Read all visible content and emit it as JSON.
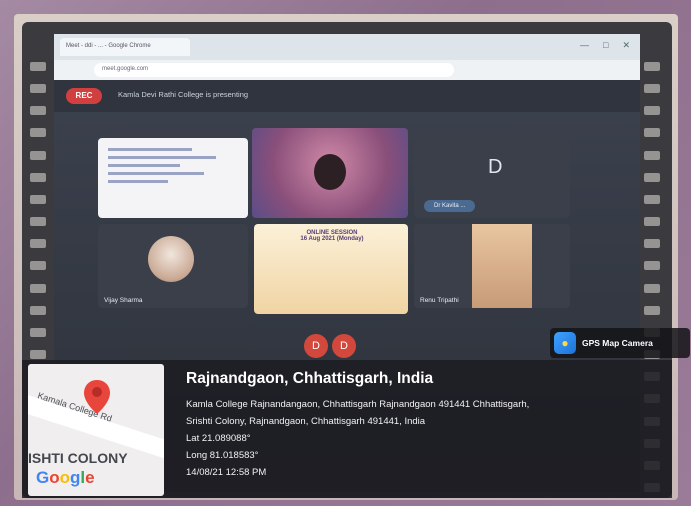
{
  "meet": {
    "browser_tab": "Meet - ddi - ... - Google Chrome",
    "address": "meet.google.com",
    "rec_label": "REC",
    "presenting_text": "Kamla Devi Rathi College is presenting",
    "tiles": {
      "cam1_name": "",
      "d_letter": "D",
      "d_name": "Dr Kavita ...",
      "vijay_name": "Vijay Sharma",
      "renu_name": "Renu Tripathi",
      "banner_line1": "ONLINE SESSION",
      "banner_line2": "16 Aug 2021 (Monday)"
    },
    "dd_left": "D",
    "dd_right": "D"
  },
  "gps": {
    "app_label": "GPS Map Camera",
    "map_road_label": "Kamala College Rd",
    "map_area_label": "ISHTI COLONY",
    "map_logo": [
      "G",
      "o",
      "o",
      "g",
      "l",
      "e"
    ],
    "city": "Rajnandgaon, Chhattisgarh, India",
    "address_line1": "Kamla College Rajnandangaon, Chhattisgarh Rajnandgaon 491441 Chhattisgarh,",
    "address_line2": "Srishti Colony, Rajnandgaon, Chhattisgarh 491441, India",
    "lat": "Lat 21.089088°",
    "long": "Long 81.018583°",
    "datetime": "14/08/21 12:58 PM"
  },
  "colors": {
    "rec": "#d23f3f",
    "pin": "#e8453c",
    "panel": "#1c1c22"
  }
}
